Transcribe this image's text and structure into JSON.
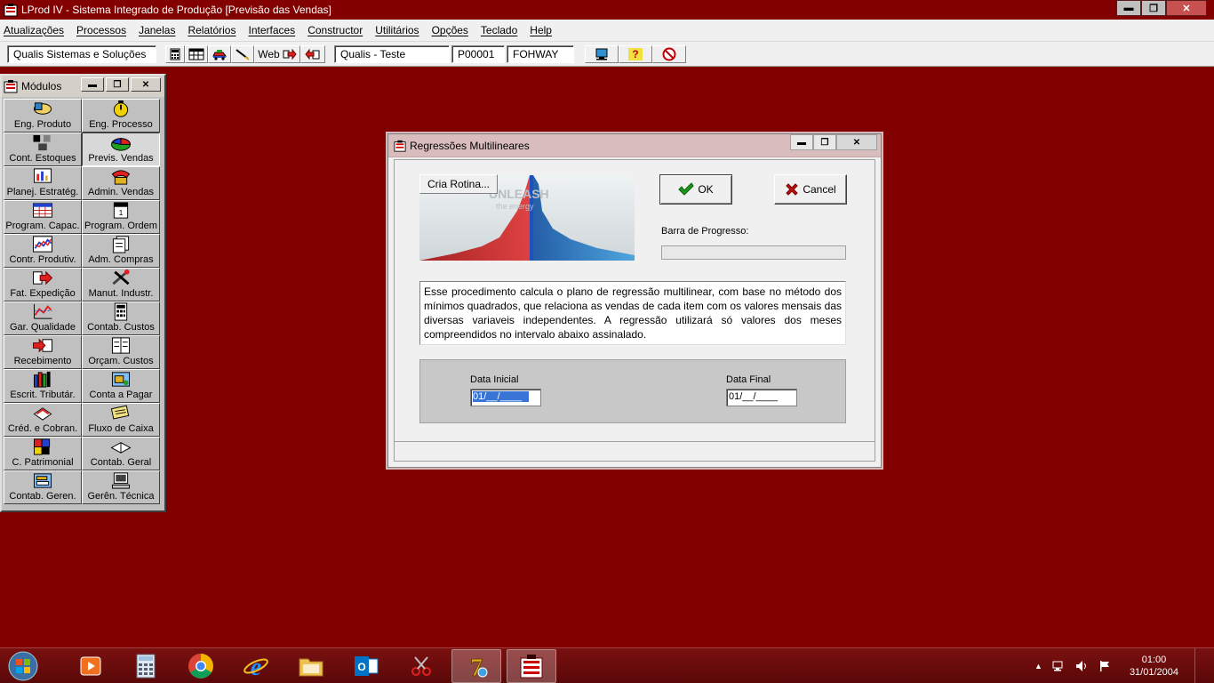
{
  "app": {
    "title": "LProd IV - Sistema Integrado de Produção [Previsão das Vendas]",
    "minimize": "▬",
    "maximize": "❐",
    "close": "✕"
  },
  "menu": [
    "Atualizações",
    "Processos",
    "Janelas",
    "Relatórios",
    "Interfaces",
    "Constructor",
    "Utilitários",
    "Opções",
    "Teclado",
    "Help"
  ],
  "toolbar": {
    "company": "Qualis Sistemas e Soluções",
    "web_label": "Web",
    "environment": "Qualis - Teste",
    "code": "P00001",
    "user": "FOHWAY",
    "help_label": "?"
  },
  "modulos": {
    "title": "Módulos",
    "minimize": "▬",
    "restore": "❐",
    "close": "✕",
    "items": [
      {
        "label": "Eng. Produto"
      },
      {
        "label": "Eng. Processo"
      },
      {
        "label": "Cont. Estoques"
      },
      {
        "label": "Previs. Vendas"
      },
      {
        "label": "Planej. Estratég."
      },
      {
        "label": "Admin. Vendas"
      },
      {
        "label": "Program. Capac."
      },
      {
        "label": "Program. Ordem"
      },
      {
        "label": "Contr. Produtiv."
      },
      {
        "label": "Adm. Compras"
      },
      {
        "label": "Fat. Expedição"
      },
      {
        "label": "Manut. Industr."
      },
      {
        "label": "Gar. Qualidade"
      },
      {
        "label": "Contab. Custos"
      },
      {
        "label": "Recebimento"
      },
      {
        "label": "Orçam. Custos"
      },
      {
        "label": "Escrit. Tributár."
      },
      {
        "label": "Conta a Pagar"
      },
      {
        "label": "Créd. e Cobran."
      },
      {
        "label": "Fluxo de Caixa"
      },
      {
        "label": "C. Patrimonial"
      },
      {
        "label": "Contab. Geral"
      },
      {
        "label": "Contab. Geren."
      },
      {
        "label": "Gerên. Técnica"
      }
    ]
  },
  "dialog": {
    "title": "Regressões Multilineares",
    "cria_rotina": "Cria Rotina...",
    "ok": "OK",
    "cancel": "Cancel",
    "progress_label": "Barra de Progresso:",
    "progress": 0,
    "banner_text_1": "UNLEASH",
    "banner_text_2": "the energy",
    "description": "Esse procedimento calcula o plano de regressão multilinear, com base no método dos mínimos quadrados, que relaciona as vendas de cada item com os valores mensais das diversas variaveis independentes. A regressão utilizará só valores dos meses compreendidos no intervalo abaixo assinalado.",
    "data_inicial_label": "Data Inicial",
    "data_inicial_value": "01/__/____",
    "data_final_label": "Data Final",
    "data_final_value": "01/__/____"
  },
  "taskbar": {
    "time": "01:00",
    "date": "31/01/2004"
  },
  "colors": {
    "desktop": "#800000",
    "selection": "#3875d7",
    "ok_check": "#1a9a1a",
    "cancel_x": "#c01010"
  }
}
